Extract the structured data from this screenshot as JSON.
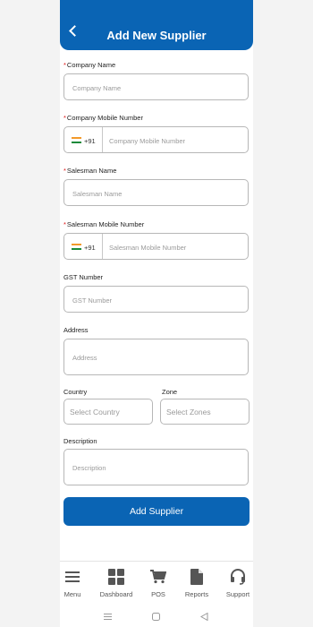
{
  "header": {
    "title": "Add New Supplier"
  },
  "form": {
    "company_name": {
      "label": "Company Name",
      "placeholder": "Company Name"
    },
    "company_mobile": {
      "label": "Company Mobile Number",
      "country_code": "+91",
      "placeholder": "Company Mobile Number"
    },
    "salesman_name": {
      "label": "Salesman Name",
      "placeholder": "Salesman Name"
    },
    "salesman_mobile": {
      "label": "Salesman Mobile Number",
      "country_code": "+91",
      "placeholder": "Salesman Mobile Number"
    },
    "gst": {
      "label": "GST Number",
      "placeholder": "GST Number"
    },
    "address": {
      "label": "Address",
      "placeholder": "Address"
    },
    "country": {
      "label": "Country",
      "value": "Select Country"
    },
    "zone": {
      "label": "Zone",
      "value": "Select Zones"
    },
    "description": {
      "label": "Description",
      "placeholder": "Description"
    },
    "submit_label": "Add Supplier"
  },
  "bottom_nav": [
    {
      "label": "Menu",
      "icon": "menu-icon"
    },
    {
      "label": "Dashboard",
      "icon": "dashboard-icon"
    },
    {
      "label": "POS",
      "icon": "cart-icon"
    },
    {
      "label": "Reports",
      "icon": "document-icon"
    },
    {
      "label": "Support",
      "icon": "headset-icon"
    }
  ],
  "colors": {
    "primary": "#0a64b4",
    "required": "#dd1111"
  }
}
